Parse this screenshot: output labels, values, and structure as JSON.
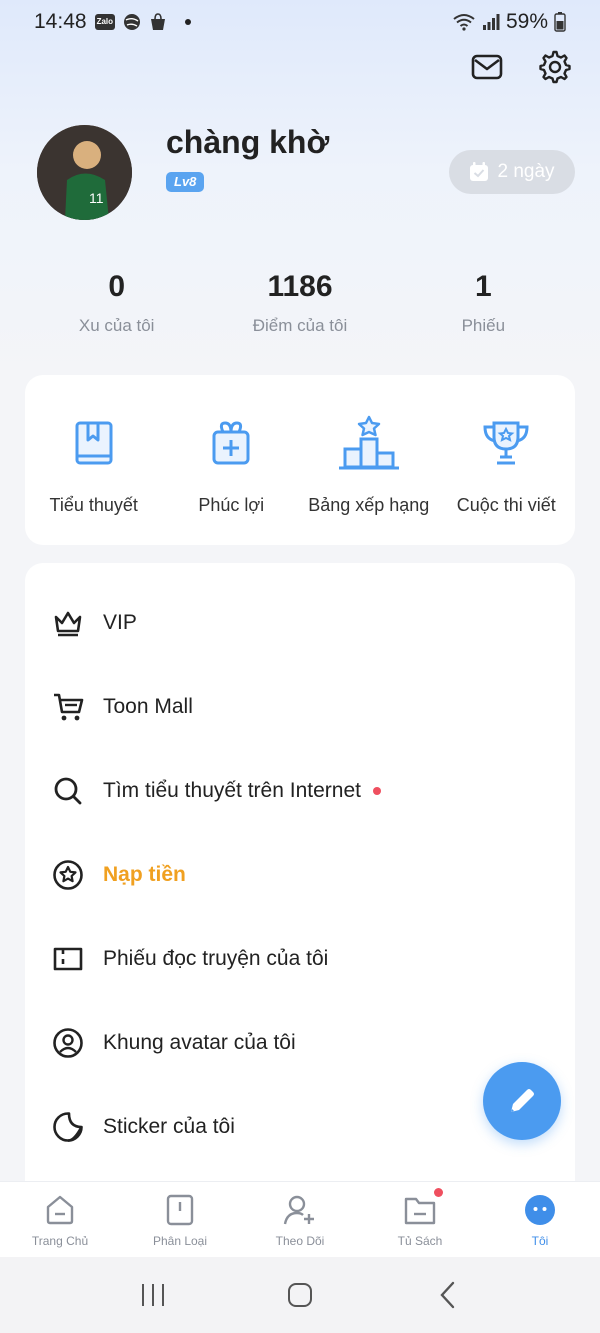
{
  "status_bar": {
    "time": "14:48",
    "zalo": "Zalo",
    "battery": "59%"
  },
  "profile": {
    "username": "chàng khờ",
    "level": "Lv8",
    "checkin_label": "2 ngày"
  },
  "stats": [
    {
      "value": "0",
      "label": "Xu của tôi"
    },
    {
      "value": "1186",
      "label": "Điểm của tôi"
    },
    {
      "value": "1",
      "label": "Phiếu"
    }
  ],
  "quick_links": [
    {
      "label": "Tiểu thuyết",
      "icon": "book-icon"
    },
    {
      "label": "Phúc lợi",
      "icon": "gift-icon"
    },
    {
      "label": "Bảng xếp hạng",
      "icon": "podium-icon"
    },
    {
      "label": "Cuộc thi viết",
      "icon": "trophy-icon"
    }
  ],
  "menu": [
    {
      "label": "VIP",
      "icon": "crown-icon"
    },
    {
      "label": "Toon Mall",
      "icon": "cart-icon"
    },
    {
      "label": "Tìm tiểu thuyết trên Internet",
      "icon": "search-icon",
      "has_dot": true
    },
    {
      "label": "Nạp tiền",
      "icon": "star-circle-icon",
      "accent": "#f0a020"
    },
    {
      "label": "Phiếu đọc truyện của tôi",
      "icon": "ticket-icon"
    },
    {
      "label": "Khung avatar của tôi",
      "icon": "avatar-frame-icon"
    },
    {
      "label": "Sticker của tôi",
      "icon": "sticker-icon"
    }
  ],
  "bottom_nav": [
    {
      "label": "Trang Chủ",
      "icon": "home-icon"
    },
    {
      "label": "Phân Loại",
      "icon": "category-icon"
    },
    {
      "label": "Theo Dõi",
      "icon": "follow-icon"
    },
    {
      "label": "Tủ Sách",
      "icon": "bookshelf-icon",
      "has_badge": true
    },
    {
      "label": "Tôi",
      "icon": "me-icon",
      "active": true
    }
  ],
  "colors": {
    "accent_blue": "#4b9bf0",
    "accent_orange": "#f0a020",
    "badge_red": "#ef4f5f"
  }
}
